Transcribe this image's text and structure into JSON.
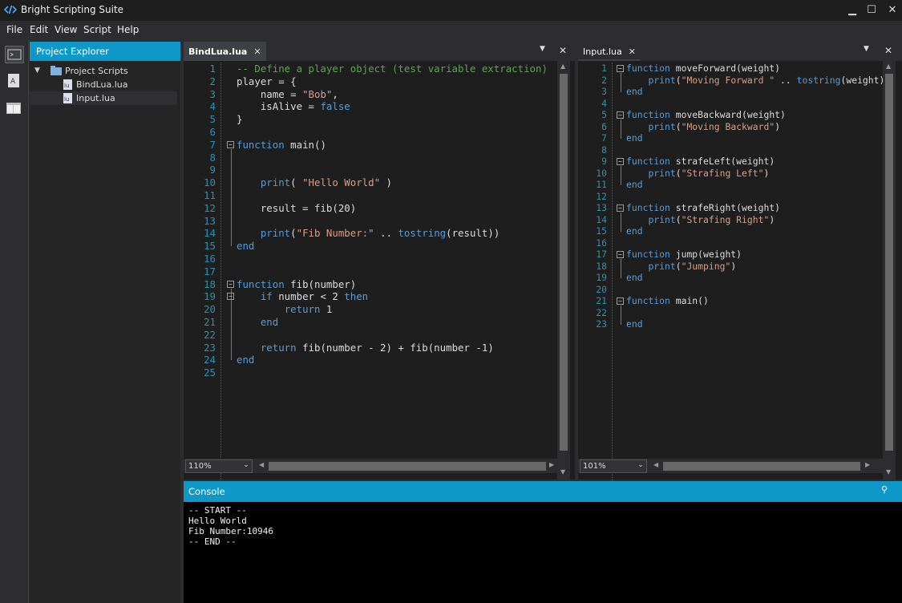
{
  "app": {
    "title": "Bright Scripting Suite"
  },
  "window_controls": {
    "minimize": "▁",
    "maximize": "☐",
    "close": "✕"
  },
  "menu": [
    "File",
    "Edit",
    "View",
    "Script",
    "Help"
  ],
  "explorer": {
    "title": "Project Explorer",
    "root": "Project Scripts",
    "files": [
      "BindLua.lua",
      "Input.lua"
    ]
  },
  "editor_left": {
    "tab": "BindLua.lua",
    "close": "✕",
    "menu_icon": "▼",
    "zoom": "110%",
    "lines": [
      [
        [
          "cm",
          "-- Define a player object (test variable extraction)"
        ]
      ],
      [
        [
          "t",
          "player = {"
        ]
      ],
      [
        [
          "t",
          "    name = "
        ],
        [
          "str",
          "\"Bob\""
        ],
        [
          "t",
          ","
        ]
      ],
      [
        [
          "t",
          "    isAlive = "
        ],
        [
          "kw",
          "false"
        ]
      ],
      [
        [
          "t",
          "}"
        ]
      ],
      [],
      [
        [
          "kw",
          "function"
        ],
        [
          "t",
          " main()"
        ]
      ],
      [],
      [],
      [
        [
          "t",
          "    "
        ],
        [
          "kw",
          "print"
        ],
        [
          "t",
          "( "
        ],
        [
          "str",
          "\"Hello World\""
        ],
        [
          "t",
          " )"
        ]
      ],
      [],
      [
        [
          "t",
          "    result = fib(20)"
        ]
      ],
      [],
      [
        [
          "t",
          "    "
        ],
        [
          "kw",
          "print"
        ],
        [
          "t",
          "("
        ],
        [
          "str",
          "\"Fib Number:\""
        ],
        [
          "t",
          " .. "
        ],
        [
          "kw",
          "tostring"
        ],
        [
          "t",
          "(result))"
        ]
      ],
      [
        [
          "kw",
          "end"
        ]
      ],
      [],
      [],
      [
        [
          "kw",
          "function"
        ],
        [
          "t",
          " fib(number)"
        ]
      ],
      [
        [
          "t",
          "    "
        ],
        [
          "kw",
          "if"
        ],
        [
          "t",
          " number < 2 "
        ],
        [
          "kw",
          "then"
        ]
      ],
      [
        [
          "t",
          "        "
        ],
        [
          "kw",
          "return"
        ],
        [
          "t",
          " 1"
        ]
      ],
      [
        [
          "t",
          "    "
        ],
        [
          "kw",
          "end"
        ]
      ],
      [],
      [
        [
          "t",
          "    "
        ],
        [
          "kw",
          "return"
        ],
        [
          "t",
          " fib(number - 2) + fib(number -1)"
        ]
      ],
      [
        [
          "kw",
          "end"
        ]
      ],
      []
    ]
  },
  "editor_right": {
    "tab": "Input.lua",
    "close": "✕",
    "menu_icon": "▼",
    "zoom": "101%",
    "lines": [
      [
        [
          "kw",
          "function"
        ],
        [
          "t",
          " moveForward(weight)"
        ]
      ],
      [
        [
          "t",
          "    "
        ],
        [
          "kw",
          "print"
        ],
        [
          "t",
          "("
        ],
        [
          "str",
          "\"Moving Forward \""
        ],
        [
          "t",
          " .. "
        ],
        [
          "kw",
          "tostring"
        ],
        [
          "t",
          "(weight)"
        ]
      ],
      [
        [
          "kw",
          "end"
        ]
      ],
      [],
      [
        [
          "kw",
          "function"
        ],
        [
          "t",
          " moveBackward(weight)"
        ]
      ],
      [
        [
          "t",
          "    "
        ],
        [
          "kw",
          "print"
        ],
        [
          "t",
          "("
        ],
        [
          "str",
          "\"Moving Backward\""
        ],
        [
          "t",
          ")"
        ]
      ],
      [
        [
          "kw",
          "end"
        ]
      ],
      [],
      [
        [
          "kw",
          "function"
        ],
        [
          "t",
          " strafeLeft(weight)"
        ]
      ],
      [
        [
          "t",
          "    "
        ],
        [
          "kw",
          "print"
        ],
        [
          "t",
          "("
        ],
        [
          "str",
          "\"Strafing Left\""
        ],
        [
          "t",
          ")"
        ]
      ],
      [
        [
          "kw",
          "end"
        ]
      ],
      [],
      [
        [
          "kw",
          "function"
        ],
        [
          "t",
          " strafeRight(weight)"
        ]
      ],
      [
        [
          "t",
          "    "
        ],
        [
          "kw",
          "print"
        ],
        [
          "t",
          "("
        ],
        [
          "str",
          "\"Strafing Right\""
        ],
        [
          "t",
          ")"
        ]
      ],
      [
        [
          "kw",
          "end"
        ]
      ],
      [],
      [
        [
          "kw",
          "function"
        ],
        [
          "t",
          " jump(weight)"
        ]
      ],
      [
        [
          "t",
          "    "
        ],
        [
          "kw",
          "print"
        ],
        [
          "t",
          "("
        ],
        [
          "str",
          "\"Jumping\""
        ],
        [
          "t",
          ")"
        ]
      ],
      [
        [
          "kw",
          "end"
        ]
      ],
      [],
      [
        [
          "kw",
          "function"
        ],
        [
          "t",
          " main()"
        ]
      ],
      [],
      [
        [
          "kw",
          "end"
        ]
      ]
    ]
  },
  "console": {
    "title": "Console",
    "pin": "📌",
    "output": [
      "-- START --",
      "Hello World",
      "Fib Number:10946",
      "-- END --"
    ]
  }
}
